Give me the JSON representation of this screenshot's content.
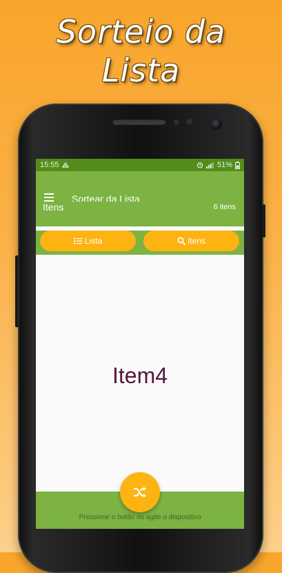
{
  "promo": {
    "line1": "Sorteio da",
    "line2": "Lista"
  },
  "status_bar": {
    "time": "15:55",
    "battery": "51%"
  },
  "app": {
    "title": "Sortear da Lista"
  },
  "section": {
    "title": "Itens",
    "count": "6 itens"
  },
  "buttons": {
    "lista": "Lista",
    "itens": "Itens"
  },
  "result": {
    "drawn_item": "Item4"
  },
  "footer": {
    "hint": "Pressione o botão ou agite o dispositivo"
  },
  "colors": {
    "primary_green": "#7cb342",
    "status_green": "#548c1c",
    "accent_amber": "#fdb312",
    "result_text": "#54163a"
  }
}
